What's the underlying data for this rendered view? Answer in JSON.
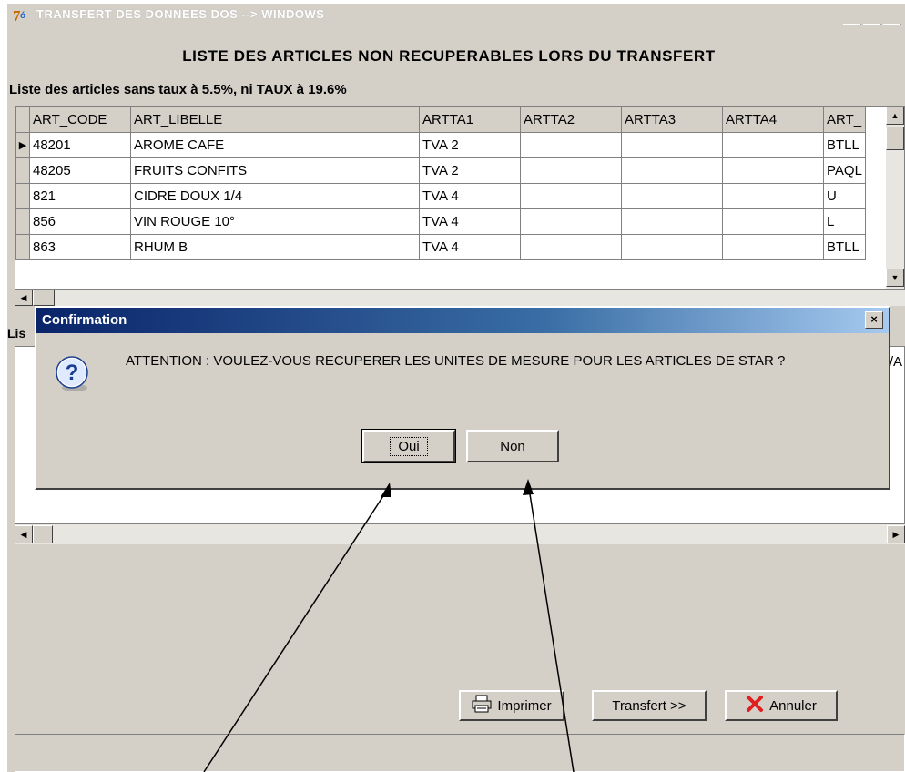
{
  "window": {
    "title": "TRANSFERT DES DONNEES DOS --> WINDOWS"
  },
  "heading": "LISTE DES ARTICLES NON RECUPERABLES LORS DU TRANSFERT",
  "grid1": {
    "caption": "Liste des articles sans taux à 5.5%, ni TAUX à 19.6%",
    "columns": [
      "ART_CODE",
      "ART_LIBELLE",
      "ARTTA1",
      "ARTTA2",
      "ARTTA3",
      "ARTTA4",
      "ART_"
    ],
    "rows": [
      [
        "48201",
        "AROME CAFE",
        "TVA 2",
        "",
        "",
        "",
        "BTLL"
      ],
      [
        "48205",
        "FRUITS CONFITS",
        "TVA 2",
        "",
        "",
        "",
        "PAQL"
      ],
      [
        "821",
        "CIDRE DOUX 1/4",
        "TVA 4",
        "",
        "",
        "",
        "U"
      ],
      [
        "856",
        "VIN ROUGE 10°",
        "TVA 4",
        "",
        "",
        "",
        "L"
      ],
      [
        "863",
        "RHUM B",
        "TVA 4",
        "",
        "",
        "",
        "BTLL"
      ]
    ]
  },
  "grid2": {
    "caption": "Lis",
    "partial_col": "/A"
  },
  "dialog": {
    "title": "Confirmation",
    "message": "ATTENTION : VOULEZ-VOUS RECUPERER LES UNITES DE MESURE POUR LES ARTICLES DE STAR ?",
    "yes_label": "Oui",
    "no_label": "Non"
  },
  "buttons": {
    "print_label": "Imprimer",
    "transfer_label": "Transfert >>",
    "cancel_label": "Annuler"
  },
  "icons": {
    "question": "question-icon",
    "printer": "printer-icon",
    "cancel": "red-x-icon"
  },
  "colors": {
    "dialog_title": "#0a246a",
    "face": "#d4d0c8",
    "cancel_x": "#e02020"
  }
}
